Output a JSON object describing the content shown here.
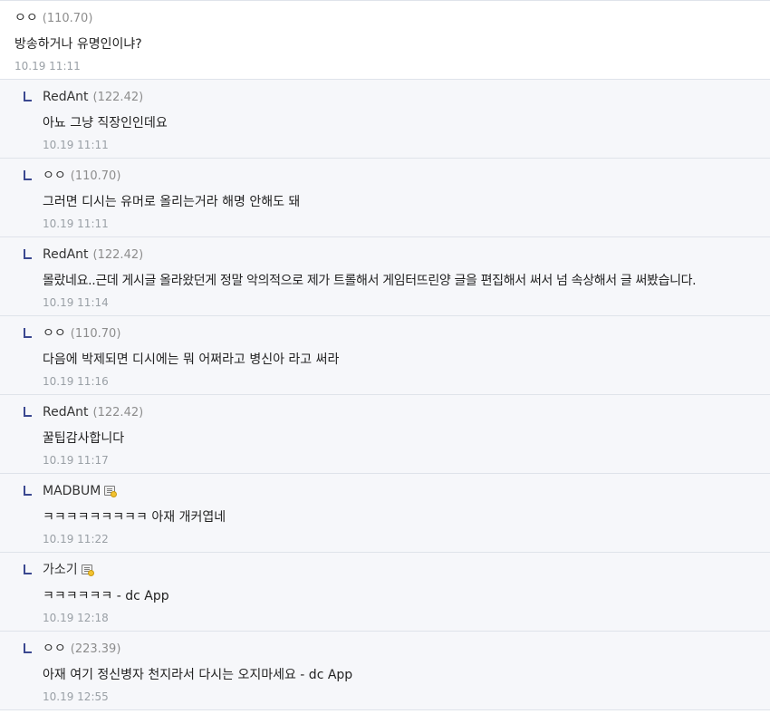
{
  "comments": [
    {
      "nick": "ㅇㅇ",
      "ip": "(110.70)",
      "text": "방송하거나 유명인이냐?",
      "date": "10.19 11:11"
    },
    {
      "nick": "RedAnt",
      "ip": "(122.42)",
      "text": "아뇨 그냥 직장인인데요",
      "date": "10.19 11:11"
    },
    {
      "nick": "ㅇㅇ",
      "ip": "(110.70)",
      "text": "그러면 디시는 유머로 올리는거라 해명 안해도 돼",
      "date": "10.19 11:11"
    },
    {
      "nick": "RedAnt",
      "ip": "(122.42)",
      "text": "몰랐네요..근데 게시글 올라왔던게 정말 악의적으로 제가 트롤해서 게임터뜨린양 글을 편집해서 써서 넘 속상해서 글 써봤습니다.",
      "date": "10.19 11:14"
    },
    {
      "nick": "ㅇㅇ",
      "ip": "(110.70)",
      "text": "다음에 박제되면 디시에는 뭐 어쩌라고 병신아 라고 써라",
      "date": "10.19 11:16"
    },
    {
      "nick": "RedAnt",
      "ip": "(122.42)",
      "text": "꿀팁감사합니다",
      "date": "10.19 11:17"
    },
    {
      "nick": "MADBUM",
      "ip": "",
      "text": "ㅋㅋㅋㅋㅋㅋㅋㅋㅋ 아재 개커엽네",
      "date": "10.19 11:22"
    },
    {
      "nick": "가소기",
      "ip": "",
      "text": "ㅋㅋㅋㅋㅋㅋ - dc App",
      "date": "10.19 12:18"
    },
    {
      "nick": "ㅇㅇ",
      "ip": "(223.39)",
      "text": "아재 여기 정신병자 천지라서 다시는 오지마세요 - dc App",
      "date": "10.19 12:55"
    }
  ],
  "icons": {
    "reply": "reply-arrow-icon",
    "member": "gallery-member-icon"
  }
}
